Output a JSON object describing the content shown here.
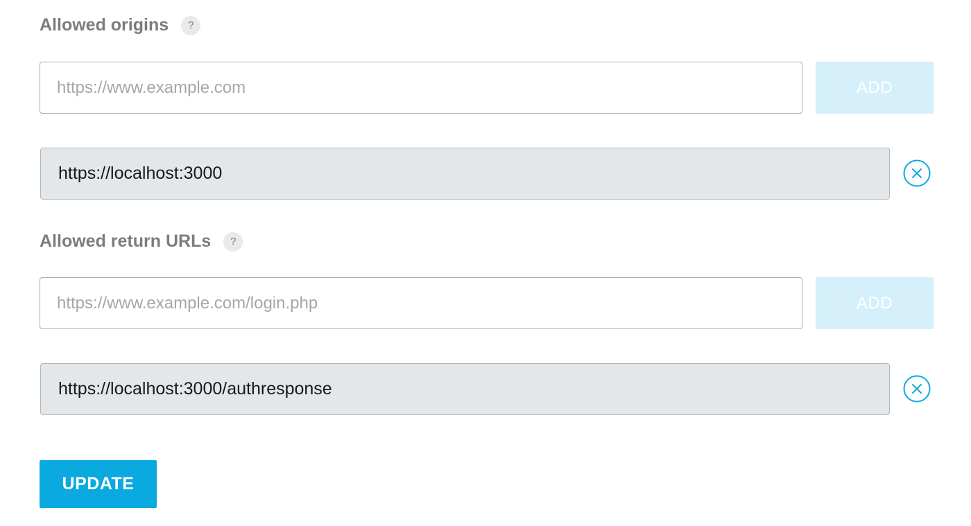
{
  "origins": {
    "label": "Allowed origins",
    "help_icon": "?",
    "input_placeholder": "https://www.example.com",
    "input_value": "",
    "add_label": "ADD",
    "entries": [
      "https://localhost:3000"
    ],
    "remove_icon": "close-circle-icon"
  },
  "return_urls": {
    "label": "Allowed return URLs",
    "help_icon": "?",
    "input_placeholder": "https://www.example.com/login.php",
    "input_value": "",
    "add_label": "ADD",
    "entries": [
      "https://localhost:3000/authresponse"
    ],
    "remove_icon": "close-circle-icon"
  },
  "update_label": "UPDATE",
  "colors": {
    "accent": "#0aa9e0",
    "add_disabled": "#d5f0fb",
    "label_gray": "#7a7d80",
    "entry_bg": "#e4e7ea"
  }
}
